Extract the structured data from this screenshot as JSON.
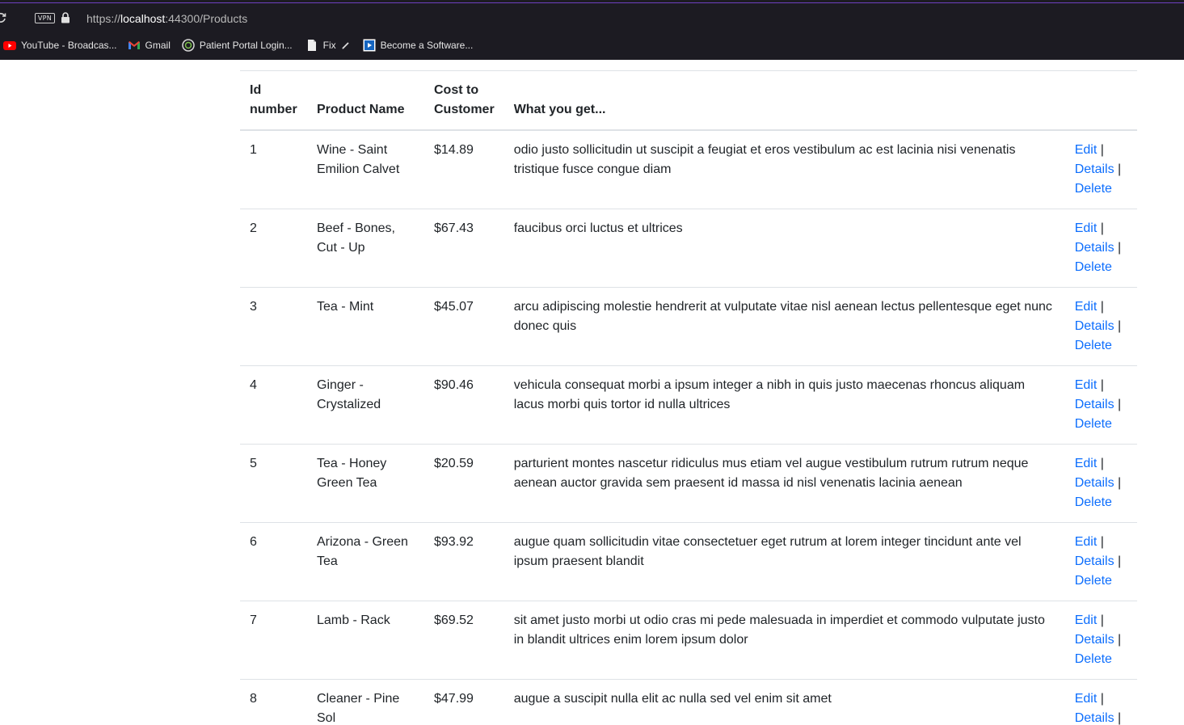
{
  "browser": {
    "url_prefix": "https://",
    "url_host": "localhost",
    "url_rest": ":44300/Products",
    "vpn_label": "VPN",
    "bookmarks": [
      {
        "label": "YouTube - Broadcas...",
        "icon": "youtube-icon"
      },
      {
        "label": "Gmail",
        "icon": "gmail-icon"
      },
      {
        "label": "Patient Portal Login...",
        "icon": "portal-icon"
      },
      {
        "label": "Fix",
        "icon": "document-icon"
      },
      {
        "label": "Become a Software...",
        "icon": "video-icon"
      }
    ]
  },
  "table": {
    "headers": {
      "id": "Id number",
      "name": "Product Name",
      "cost": "Cost to Customer",
      "desc": "What you get..."
    },
    "action_labels": {
      "edit": "Edit",
      "details": "Details",
      "delete": "Delete",
      "separator": "|"
    },
    "rows": [
      {
        "id": "1",
        "name": "Wine - Saint Emilion Calvet",
        "cost": "$14.89",
        "desc": "odio justo sollicitudin ut suscipit a feugiat et eros vestibulum ac est lacinia nisi venenatis tristique fusce congue diam"
      },
      {
        "id": "2",
        "name": "Beef - Bones, Cut - Up",
        "cost": "$67.43",
        "desc": "faucibus orci luctus et ultrices"
      },
      {
        "id": "3",
        "name": "Tea - Mint",
        "cost": "$45.07",
        "desc": "arcu adipiscing molestie hendrerit at vulputate vitae nisl aenean lectus pellentesque eget nunc donec quis"
      },
      {
        "id": "4",
        "name": "Ginger - Crystalized",
        "cost": "$90.46",
        "desc": "vehicula consequat morbi a ipsum integer a nibh in quis justo maecenas rhoncus aliquam lacus morbi quis tortor id nulla ultrices"
      },
      {
        "id": "5",
        "name": "Tea - Honey Green Tea",
        "cost": "$20.59",
        "desc": "parturient montes nascetur ridiculus mus etiam vel augue vestibulum rutrum rutrum neque aenean auctor gravida sem praesent id massa id nisl venenatis lacinia aenean"
      },
      {
        "id": "6",
        "name": "Arizona - Green Tea",
        "cost": "$93.92",
        "desc": "augue quam sollicitudin vitae consectetuer eget rutrum at lorem integer tincidunt ante vel ipsum praesent blandit"
      },
      {
        "id": "7",
        "name": "Lamb - Rack",
        "cost": "$69.52",
        "desc": "sit amet justo morbi ut odio cras mi pede malesuada in imperdiet et commodo vulputate justo in blandit ultrices enim lorem ipsum dolor"
      },
      {
        "id": "8",
        "name": "Cleaner - Pine Sol",
        "cost": "$47.99",
        "desc": "augue a suscipit nulla elit ac nulla sed vel enim sit amet"
      }
    ]
  },
  "colors": {
    "chrome_bg": "#1c1b22",
    "link": "#0d6efd",
    "text": "#212529",
    "border": "#dee2e6"
  }
}
